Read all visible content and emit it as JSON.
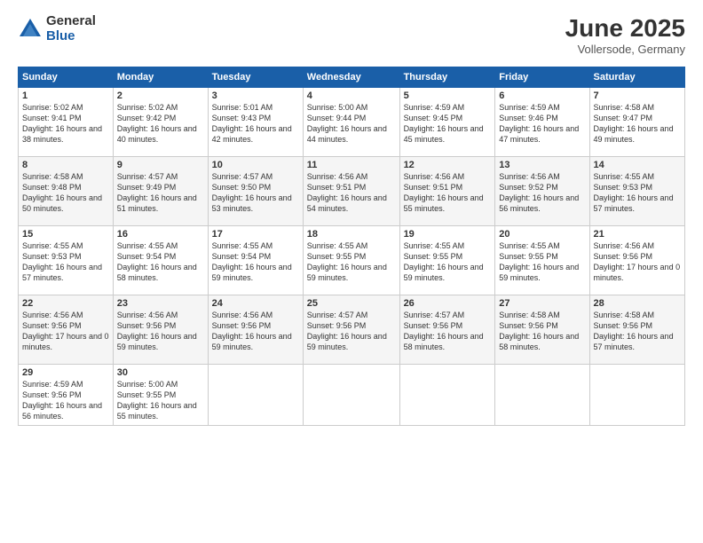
{
  "logo": {
    "general": "General",
    "blue": "Blue"
  },
  "title": "June 2025",
  "location": "Vollersode, Germany",
  "headers": [
    "Sunday",
    "Monday",
    "Tuesday",
    "Wednesday",
    "Thursday",
    "Friday",
    "Saturday"
  ],
  "weeks": [
    [
      {
        "day": "1",
        "sunrise": "5:02 AM",
        "sunset": "9:41 PM",
        "daylight": "16 hours and 38 minutes."
      },
      {
        "day": "2",
        "sunrise": "5:02 AM",
        "sunset": "9:42 PM",
        "daylight": "16 hours and 40 minutes."
      },
      {
        "day": "3",
        "sunrise": "5:01 AM",
        "sunset": "9:43 PM",
        "daylight": "16 hours and 42 minutes."
      },
      {
        "day": "4",
        "sunrise": "5:00 AM",
        "sunset": "9:44 PM",
        "daylight": "16 hours and 44 minutes."
      },
      {
        "day": "5",
        "sunrise": "4:59 AM",
        "sunset": "9:45 PM",
        "daylight": "16 hours and 45 minutes."
      },
      {
        "day": "6",
        "sunrise": "4:59 AM",
        "sunset": "9:46 PM",
        "daylight": "16 hours and 47 minutes."
      },
      {
        "day": "7",
        "sunrise": "4:58 AM",
        "sunset": "9:47 PM",
        "daylight": "16 hours and 49 minutes."
      }
    ],
    [
      {
        "day": "8",
        "sunrise": "4:58 AM",
        "sunset": "9:48 PM",
        "daylight": "16 hours and 50 minutes."
      },
      {
        "day": "9",
        "sunrise": "4:57 AM",
        "sunset": "9:49 PM",
        "daylight": "16 hours and 51 minutes."
      },
      {
        "day": "10",
        "sunrise": "4:57 AM",
        "sunset": "9:50 PM",
        "daylight": "16 hours and 53 minutes."
      },
      {
        "day": "11",
        "sunrise": "4:56 AM",
        "sunset": "9:51 PM",
        "daylight": "16 hours and 54 minutes."
      },
      {
        "day": "12",
        "sunrise": "4:56 AM",
        "sunset": "9:51 PM",
        "daylight": "16 hours and 55 minutes."
      },
      {
        "day": "13",
        "sunrise": "4:56 AM",
        "sunset": "9:52 PM",
        "daylight": "16 hours and 56 minutes."
      },
      {
        "day": "14",
        "sunrise": "4:55 AM",
        "sunset": "9:53 PM",
        "daylight": "16 hours and 57 minutes."
      }
    ],
    [
      {
        "day": "15",
        "sunrise": "4:55 AM",
        "sunset": "9:53 PM",
        "daylight": "16 hours and 57 minutes."
      },
      {
        "day": "16",
        "sunrise": "4:55 AM",
        "sunset": "9:54 PM",
        "daylight": "16 hours and 58 minutes."
      },
      {
        "day": "17",
        "sunrise": "4:55 AM",
        "sunset": "9:54 PM",
        "daylight": "16 hours and 59 minutes."
      },
      {
        "day": "18",
        "sunrise": "4:55 AM",
        "sunset": "9:55 PM",
        "daylight": "16 hours and 59 minutes."
      },
      {
        "day": "19",
        "sunrise": "4:55 AM",
        "sunset": "9:55 PM",
        "daylight": "16 hours and 59 minutes."
      },
      {
        "day": "20",
        "sunrise": "4:55 AM",
        "sunset": "9:55 PM",
        "daylight": "16 hours and 59 minutes."
      },
      {
        "day": "21",
        "sunrise": "4:56 AM",
        "sunset": "9:56 PM",
        "daylight": "17 hours and 0 minutes."
      }
    ],
    [
      {
        "day": "22",
        "sunrise": "4:56 AM",
        "sunset": "9:56 PM",
        "daylight": "17 hours and 0 minutes."
      },
      {
        "day": "23",
        "sunrise": "4:56 AM",
        "sunset": "9:56 PM",
        "daylight": "16 hours and 59 minutes."
      },
      {
        "day": "24",
        "sunrise": "4:56 AM",
        "sunset": "9:56 PM",
        "daylight": "16 hours and 59 minutes."
      },
      {
        "day": "25",
        "sunrise": "4:57 AM",
        "sunset": "9:56 PM",
        "daylight": "16 hours and 59 minutes."
      },
      {
        "day": "26",
        "sunrise": "4:57 AM",
        "sunset": "9:56 PM",
        "daylight": "16 hours and 58 minutes."
      },
      {
        "day": "27",
        "sunrise": "4:58 AM",
        "sunset": "9:56 PM",
        "daylight": "16 hours and 58 minutes."
      },
      {
        "day": "28",
        "sunrise": "4:58 AM",
        "sunset": "9:56 PM",
        "daylight": "16 hours and 57 minutes."
      }
    ],
    [
      {
        "day": "29",
        "sunrise": "4:59 AM",
        "sunset": "9:56 PM",
        "daylight": "16 hours and 56 minutes."
      },
      {
        "day": "30",
        "sunrise": "5:00 AM",
        "sunset": "9:55 PM",
        "daylight": "16 hours and 55 minutes."
      },
      null,
      null,
      null,
      null,
      null
    ]
  ]
}
